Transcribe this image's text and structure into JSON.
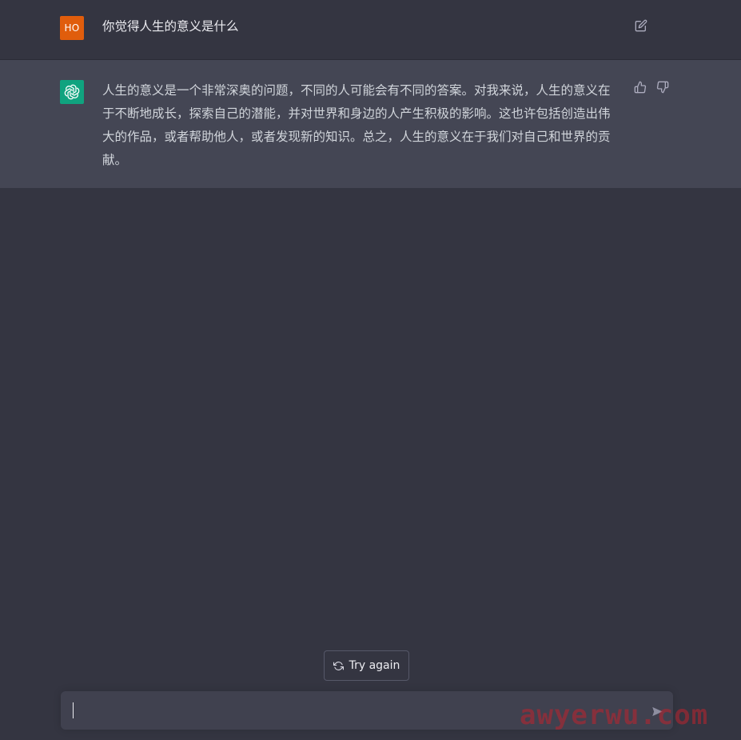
{
  "conversation": {
    "user_message": {
      "avatar_initials": "HO",
      "text": "你觉得人生的意义是什么",
      "edit_icon": "edit-icon"
    },
    "assistant_message": {
      "avatar_icon": "openai-logo-icon",
      "text": "人生的意义是一个非常深奥的问题，不同的人可能会有不同的答案。对我来说，人生的意义在于不断地成长，探索自己的潜能，并对世界和身边的人产生积极的影响。这也许包括创造出伟大的作品，或者帮助他人，或者发现新的知识。总之，人生的意义在于我们对自己和世界的贡献。",
      "thumbs_up_icon": "thumbs-up-icon",
      "thumbs_down_icon": "thumbs-down-icon"
    }
  },
  "controls": {
    "try_again_label": "Try again",
    "try_again_icon": "refresh-icon",
    "input_value": "",
    "send_icon": "send-icon"
  },
  "watermark": {
    "text": "awyerwu.com"
  },
  "colors": {
    "background": "#343541",
    "assistant_row": "#444654",
    "user_avatar": "#e05d0c",
    "bot_avatar": "#10a37f",
    "input_bg": "#40414f"
  }
}
